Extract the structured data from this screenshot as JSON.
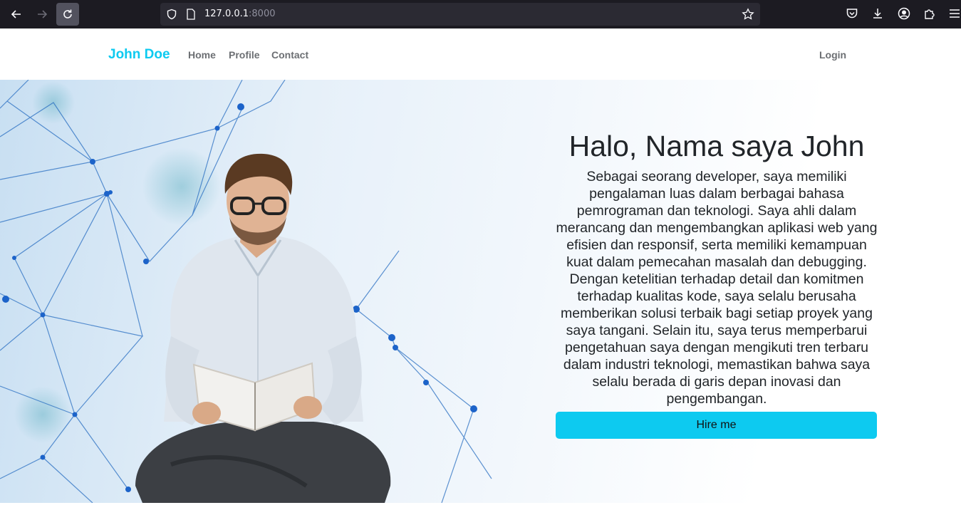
{
  "browser": {
    "url_host": "127.0.0.1",
    "url_port": ":8000"
  },
  "navbar": {
    "brand": "John Doe",
    "links": [
      "Home",
      "Profile",
      "Contact"
    ],
    "login": "Login",
    "brand_color": "#0dcaf0"
  },
  "hero": {
    "title": "Halo, Nama saya John",
    "body": "Sebagai seorang developer, saya memiliki pengalaman luas dalam berbagai bahasa pemrograman dan teknologi. Saya ahli dalam merancang dan mengembangkan aplikasi web yang efisien dan responsif, serta memiliki kemampuan kuat dalam pemecahan masalah dan debugging. Dengan ketelitian terhadap detail dan komitmen terhadap kualitas kode, saya selalu berusaha memberikan solusi terbaik bagi setiap proyek yang saya tangani. Selain itu, saya terus memperbarui pengetahuan saya dengan mengikuti tren terbaru dalam industri teknologi, memastikan bahwa saya selalu berada di garis depan inovasi dan pengembangan.",
    "cta_label": "Hire me",
    "cta_color": "#0dcaf0"
  },
  "icons": {
    "back": "arrow-left-icon",
    "forward": "arrow-right-icon",
    "reload": "reload-icon",
    "shield": "shield-icon",
    "page": "page-icon",
    "bookmark": "star-icon",
    "pocket": "pocket-icon",
    "download": "download-icon",
    "account": "account-icon",
    "extensions": "puzzle-icon",
    "menu": "hamburger-menu-icon"
  }
}
